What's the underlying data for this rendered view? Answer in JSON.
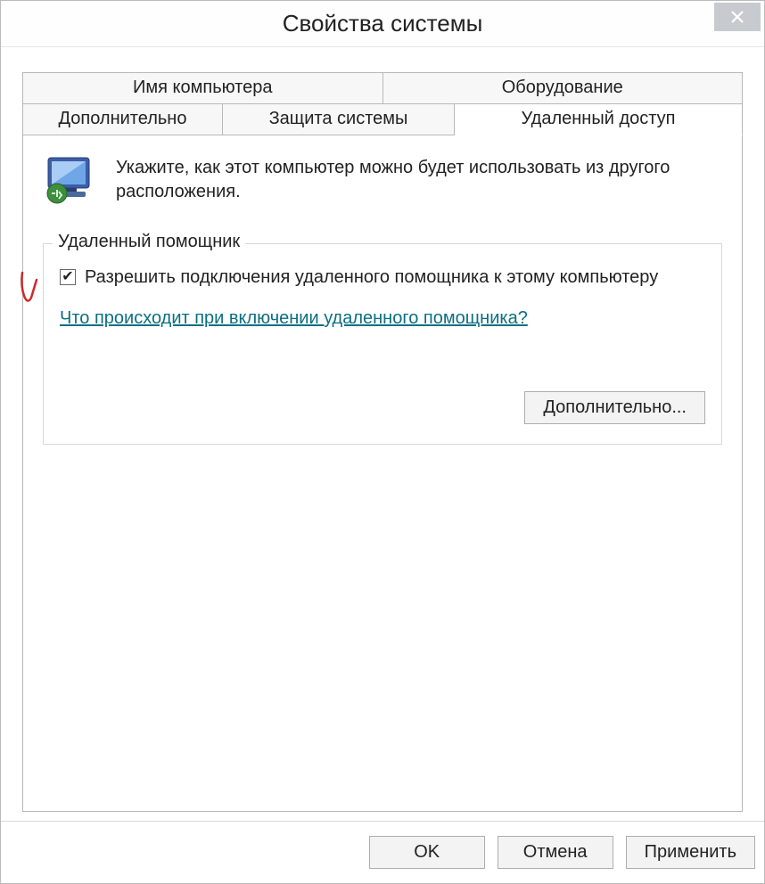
{
  "window": {
    "title": "Свойства системы"
  },
  "tabs": {
    "row1": [
      "Имя компьютера",
      "Оборудование"
    ],
    "row2": [
      "Дополнительно",
      "Защита системы",
      "Удаленный доступ"
    ],
    "selected": "Удаленный доступ"
  },
  "intro": "Укажите, как этот компьютер можно будет использовать из другого расположения.",
  "group": {
    "title": "Удаленный помощник",
    "checkbox_label": "Разрешить подключения удаленного помощника к этому компьютеру",
    "checkbox_checked": true,
    "help_link": "Что происходит при включении удаленного помощника?",
    "advanced_btn": "Дополнительно..."
  },
  "buttons": {
    "ok": "OK",
    "cancel": "Отмена",
    "apply": "Применить"
  },
  "annotation": {
    "color": "#cc2a2a"
  }
}
